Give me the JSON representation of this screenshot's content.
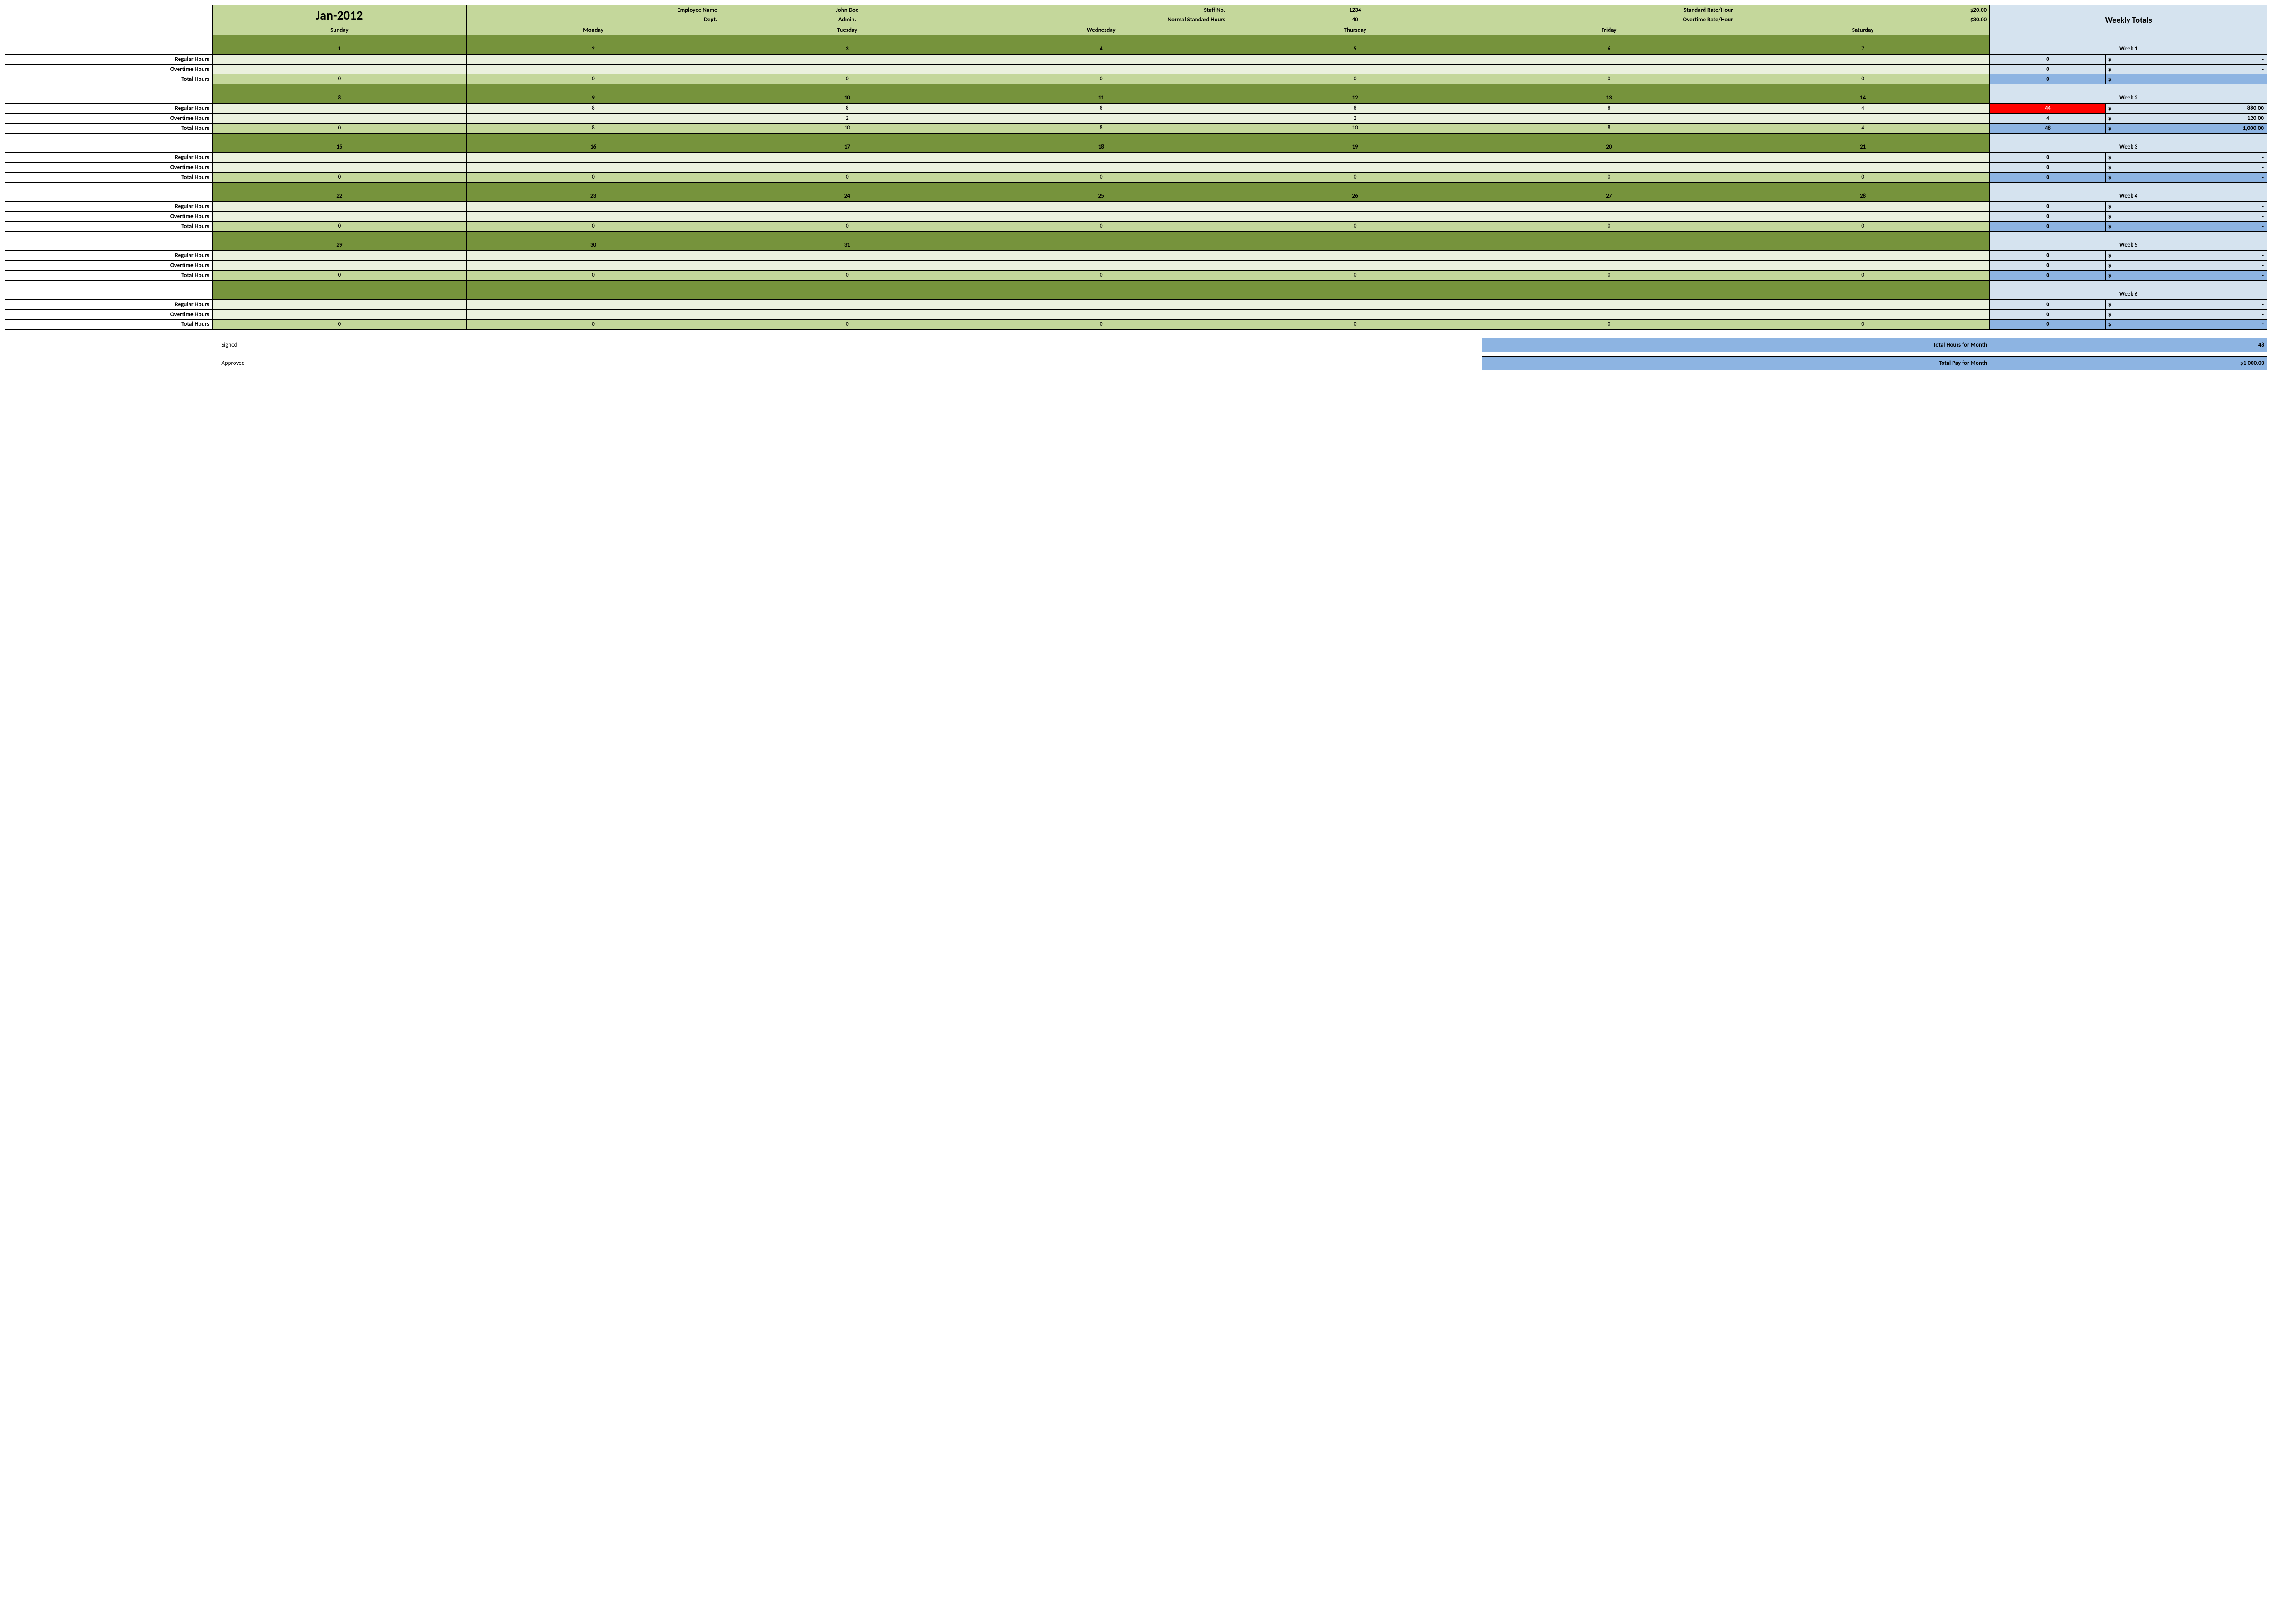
{
  "title": "Jan-2012",
  "header": {
    "emp_name_label": "Employee Name",
    "emp_name": "John Doe",
    "staff_no_label": "Staff No.",
    "staff_no": "1234",
    "std_rate_label": "Standard Rate/Hour",
    "std_rate": "$20.00",
    "dept_label": "Dept.",
    "dept": "Admin.",
    "norm_hours_label": "Normal Standard Hours",
    "norm_hours": "40",
    "ot_rate_label": "Overtime Rate/Hour",
    "ot_rate": "$30.00"
  },
  "days": [
    "Sunday",
    "Monday",
    "Tuesday",
    "Wednesday",
    "Thursday",
    "Friday",
    "Saturday"
  ],
  "weekly_totals_label": "Weekly Totals",
  "row_labels": {
    "regular": "Regular Hours",
    "overtime": "Overtime Hours",
    "total": "Total Hours"
  },
  "weeks": [
    {
      "label": "Week 1",
      "dates": [
        "1",
        "2",
        "3",
        "4",
        "5",
        "6",
        "7"
      ],
      "regular": [
        "",
        "",
        "",
        "",
        "",
        "",
        ""
      ],
      "overtime": [
        "",
        "",
        "",
        "",
        "",
        "",
        ""
      ],
      "total": [
        "0",
        "0",
        "0",
        "0",
        "0",
        "0",
        "0"
      ],
      "wt_reg_n": "0",
      "wt_reg_amt": "-",
      "wt_reg_red": false,
      "wt_ot_n": "0",
      "wt_ot_amt": "-",
      "wt_tot_n": "0",
      "wt_tot_amt": "-"
    },
    {
      "label": "Week 2",
      "dates": [
        "8",
        "9",
        "10",
        "11",
        "12",
        "13",
        "14"
      ],
      "regular": [
        "",
        "8",
        "8",
        "8",
        "8",
        "8",
        "4"
      ],
      "overtime": [
        "",
        "",
        "2",
        "",
        "2",
        "",
        ""
      ],
      "total": [
        "0",
        "8",
        "10",
        "8",
        "10",
        "8",
        "4"
      ],
      "wt_reg_n": "44",
      "wt_reg_amt": "880.00",
      "wt_reg_red": true,
      "wt_ot_n": "4",
      "wt_ot_amt": "120.00",
      "wt_tot_n": "48",
      "wt_tot_amt": "1,000.00"
    },
    {
      "label": "Week 3",
      "dates": [
        "15",
        "16",
        "17",
        "18",
        "19",
        "20",
        "21"
      ],
      "regular": [
        "",
        "",
        "",
        "",
        "",
        "",
        ""
      ],
      "overtime": [
        "",
        "",
        "",
        "",
        "",
        "",
        ""
      ],
      "total": [
        "0",
        "0",
        "0",
        "0",
        "0",
        "0",
        "0"
      ],
      "wt_reg_n": "0",
      "wt_reg_amt": "-",
      "wt_reg_red": false,
      "wt_ot_n": "0",
      "wt_ot_amt": "-",
      "wt_tot_n": "0",
      "wt_tot_amt": "-"
    },
    {
      "label": "Week 4",
      "dates": [
        "22",
        "23",
        "24",
        "25",
        "26",
        "27",
        "28"
      ],
      "regular": [
        "",
        "",
        "",
        "",
        "",
        "",
        ""
      ],
      "overtime": [
        "",
        "",
        "",
        "",
        "",
        "",
        ""
      ],
      "total": [
        "0",
        "0",
        "0",
        "0",
        "0",
        "0",
        "0"
      ],
      "wt_reg_n": "0",
      "wt_reg_amt": "-",
      "wt_reg_red": false,
      "wt_ot_n": "0",
      "wt_ot_amt": "-",
      "wt_tot_n": "0",
      "wt_tot_amt": "-"
    },
    {
      "label": "Week 5",
      "dates": [
        "29",
        "30",
        "31",
        "",
        "",
        "",
        ""
      ],
      "regular": [
        "",
        "",
        "",
        "",
        "",
        "",
        ""
      ],
      "overtime": [
        "",
        "",
        "",
        "",
        "",
        "",
        ""
      ],
      "total": [
        "0",
        "0",
        "0",
        "0",
        "0",
        "0",
        "0"
      ],
      "wt_reg_n": "0",
      "wt_reg_amt": "-",
      "wt_reg_red": false,
      "wt_ot_n": "0",
      "wt_ot_amt": "-",
      "wt_tot_n": "0",
      "wt_tot_amt": "-"
    },
    {
      "label": "Week 6",
      "dates": [
        "",
        "",
        "",
        "",
        "",
        "",
        ""
      ],
      "regular": [
        "",
        "",
        "",
        "",
        "",
        "",
        ""
      ],
      "overtime": [
        "",
        "",
        "",
        "",
        "",
        "",
        ""
      ],
      "total": [
        "0",
        "0",
        "0",
        "0",
        "0",
        "0",
        "0"
      ],
      "wt_reg_n": "0",
      "wt_reg_amt": "-",
      "wt_reg_red": false,
      "wt_ot_n": "0",
      "wt_ot_amt": "-",
      "wt_tot_n": "0",
      "wt_tot_amt": "-"
    }
  ],
  "footer": {
    "signed": "Signed",
    "approved": "Approved",
    "total_hours_label": "Total Hours for Month",
    "total_hours": "48",
    "total_pay_label": "Total Pay for Month",
    "total_pay": "$1,000.00"
  }
}
